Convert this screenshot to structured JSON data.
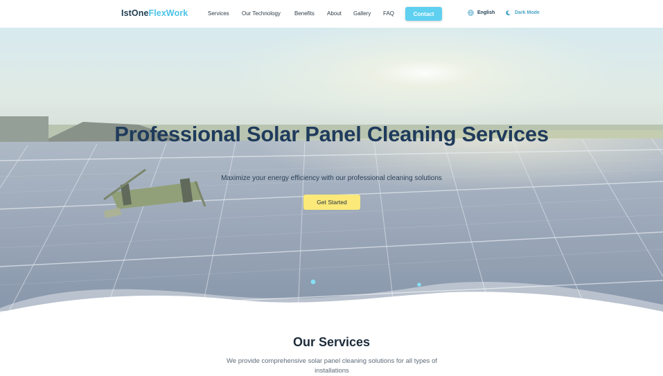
{
  "brand": {
    "part1": "IstOne",
    "part2": "FlexWork"
  },
  "nav": {
    "links": [
      "Services",
      "Our Technology",
      "Benefits",
      "About",
      "Gallery",
      "FAQ"
    ],
    "contact_label": "Contact",
    "language_label": "English",
    "mode_label": "Dark Mode"
  },
  "hero": {
    "title": "Professional Solar Panel Cleaning Services",
    "subtitle": "Maximize your energy efficiency with our professional cleaning solutions",
    "cta_label": "Get Started"
  },
  "services": {
    "title": "Our Services",
    "description": "We provide comprehensive solar panel cleaning solutions for all types of installations"
  },
  "colors": {
    "accent": "#5fd0ef",
    "brand_dark": "#1f3d52",
    "cta": "#fbe97a"
  },
  "icons": {
    "language": "globe-icon",
    "mode": "moon-icon"
  }
}
